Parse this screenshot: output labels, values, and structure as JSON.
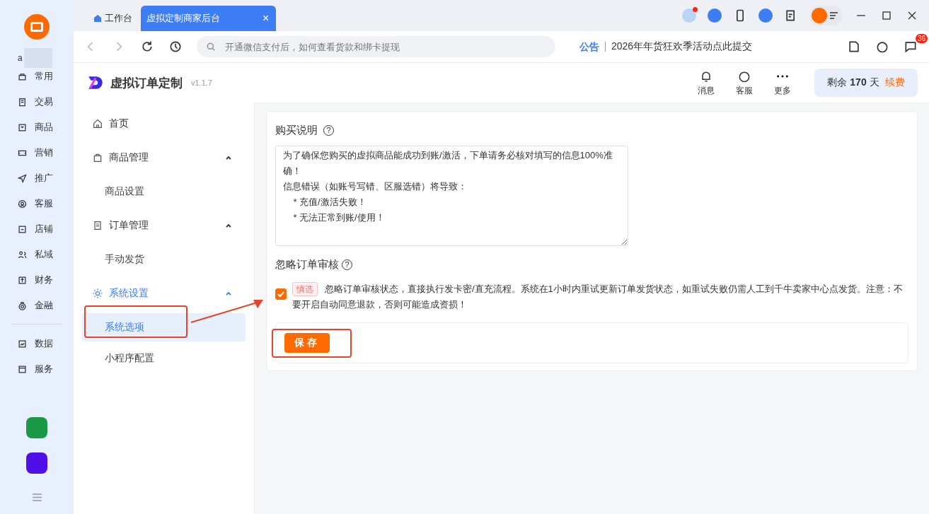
{
  "rail": {
    "user_initial": "a",
    "items": [
      {
        "label": "常用"
      },
      {
        "label": "交易"
      },
      {
        "label": "商品"
      },
      {
        "label": "营销"
      },
      {
        "label": "推广"
      },
      {
        "label": "客服"
      },
      {
        "label": "店铺"
      },
      {
        "label": "私域"
      },
      {
        "label": "财务"
      },
      {
        "label": "金融"
      },
      {
        "label": "数据"
      },
      {
        "label": "服务"
      }
    ]
  },
  "tabs": [
    {
      "label": "工作台",
      "selected": false,
      "closable": false
    },
    {
      "label": "虚拟定制商家后台",
      "selected": true,
      "closable": true,
      "close_symbol": "×"
    }
  ],
  "address_bar": {
    "placeholder": "开通微信支付后，如何查看货款和绑卡提现"
  },
  "notice": {
    "label": "公告",
    "text": "2026年年货狂欢季活动点此提交"
  },
  "messages_badge": "36",
  "app": {
    "name": "虚拟订单定制",
    "version": "v1.1.7",
    "actions": [
      {
        "label": "消息"
      },
      {
        "label": "客服"
      },
      {
        "label": "更多"
      }
    ],
    "subscription": {
      "prefix": "剩余",
      "days": "170",
      "unit": "天",
      "renew": "续费"
    }
  },
  "nav": [
    {
      "label": "首页",
      "selected": false
    },
    {
      "label": "商品管理",
      "expanded": true,
      "selected": false,
      "children": [
        {
          "label": "商品设置",
          "selected": false
        }
      ]
    },
    {
      "label": "订单管理",
      "expanded": true,
      "selected": false,
      "children": [
        {
          "label": "手动发货",
          "selected": false
        }
      ]
    },
    {
      "label": "系统设置",
      "expanded": true,
      "selected": true,
      "children": [
        {
          "label": "系统选项",
          "selected": true
        },
        {
          "label": "小程序配置",
          "selected": false
        }
      ]
    }
  ],
  "form": {
    "purchase_notes": {
      "label": "购买说明",
      "help_symbol": "?",
      "lines": [
        "为了确保您购买的虚拟商品能成功到账/激活，下单请务必核对填写的信息100%准确！",
        "信息错误（如账号写错、区服选错）将导致：",
        "    * 充值/激活失败！",
        "    * 无法正常到账/使用！"
      ]
    },
    "ignore_review": {
      "label": "忽略订单审核",
      "help_symbol": "?",
      "checked": true,
      "tag": "慎选",
      "description": "忽略订单审核状态，直接执行发卡密/直充流程。系统在1小时内重试更新订单发货状态，如重试失败仍需人工到千牛卖家中心点发货。注意：不要开启自动同意退款，否则可能造成资损！"
    },
    "save_button": "保存"
  }
}
